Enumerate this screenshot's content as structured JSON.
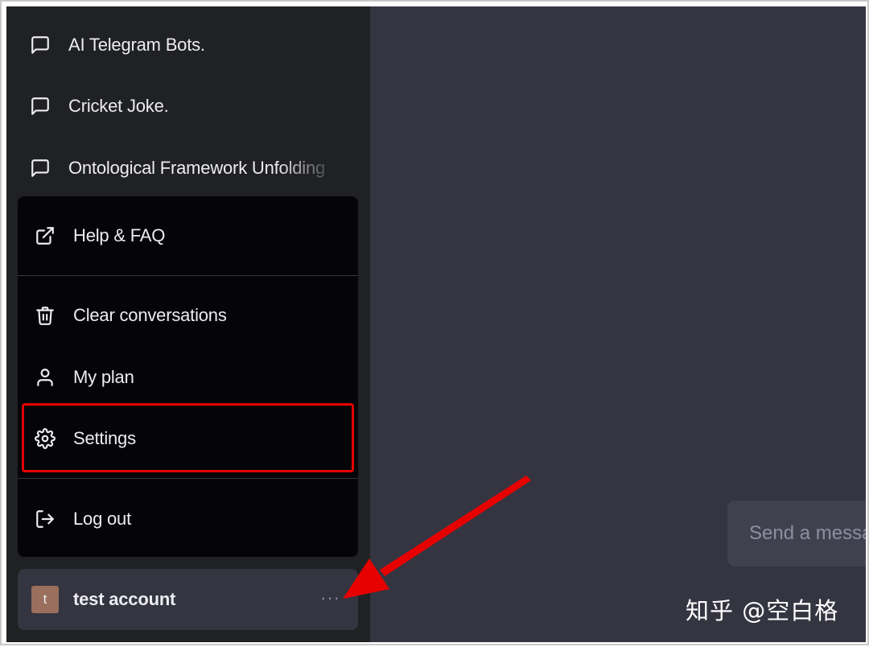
{
  "sidebar": {
    "history": [
      {
        "label": "AI Telegram Bots.",
        "icon": "chat-bubble-icon"
      },
      {
        "label": "Cricket Joke.",
        "icon": "chat-bubble-icon"
      },
      {
        "label": "Ontological Framework Unfolding",
        "icon": "chat-bubble-icon"
      }
    ]
  },
  "menu": {
    "items": [
      {
        "label": "Help & FAQ",
        "icon": "external-link-icon"
      },
      {
        "label": "Clear conversations",
        "icon": "trash-icon"
      },
      {
        "label": "My plan",
        "icon": "user-icon"
      },
      {
        "label": "Settings",
        "icon": "gear-icon"
      },
      {
        "label": "Log out",
        "icon": "logout-icon"
      }
    ],
    "highlight_color": "#e60000"
  },
  "account": {
    "avatar_letter": "t",
    "name": "test account",
    "more_icon": "ellipsis-icon"
  },
  "composer": {
    "placeholder": "Send a message"
  },
  "watermark": {
    "text": "知乎 @空白格"
  },
  "colors": {
    "sidebar_bg": "#202123",
    "menu_bg": "#050509",
    "main_bg": "#343541",
    "text": "#ececf1",
    "annotation_red": "#e60000"
  }
}
